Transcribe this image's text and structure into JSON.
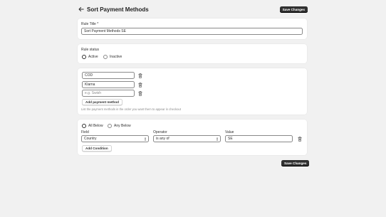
{
  "header": {
    "title": "Sort Payment Methods",
    "save_label": "Save Changes"
  },
  "rule_title": {
    "label": "Rule Title *",
    "value": "Sort Payment Methods SE"
  },
  "rule_status": {
    "label": "Rule status",
    "options": [
      "Active",
      "Inactive"
    ],
    "selected": "Active"
  },
  "payment_methods": {
    "items": [
      "COD",
      "Klarna"
    ],
    "new_placeholder": "e.g. Swish",
    "add_label": "Add payment method",
    "helper": "List the payment methods in the order you want them to appear in checkout"
  },
  "conditions": {
    "match_options": [
      "All Below",
      "Any Below"
    ],
    "selected": "All Below",
    "field_label": "Field",
    "field_value": "Country",
    "operator_label": "Operator",
    "operator_value": "is any of",
    "value_label": "Value",
    "value_value": "SE",
    "add_label": "Add Condition"
  },
  "footer": {
    "save_label": "Save Changes"
  },
  "icons": {
    "back": "arrow-left-icon",
    "trash": "trash-icon"
  }
}
